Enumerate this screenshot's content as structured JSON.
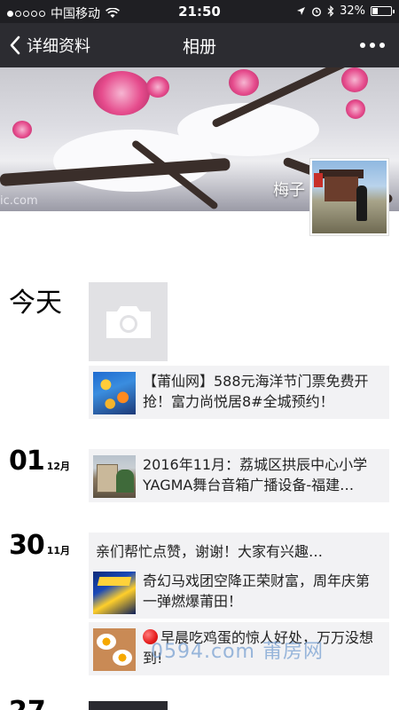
{
  "status_bar": {
    "carrier": "中国移动",
    "time": "21:50",
    "battery": "32%",
    "battery_level": 0.32,
    "icons": [
      "signal-dots-icon",
      "wifi-icon",
      "location-icon",
      "alarm-icon",
      "bluetooth-icon",
      "battery-icon"
    ]
  },
  "nav": {
    "back_label": "详细资料",
    "title": "相册"
  },
  "cover": {
    "watermark": "ic.com",
    "name": "梅子"
  },
  "timeline": {
    "today_label": "今天",
    "days": [
      {
        "day": "01",
        "month": "12月"
      },
      {
        "day": "30",
        "month": "11月"
      },
      {
        "day": "27",
        "month": ""
      }
    ],
    "entries": [
      {
        "text": "【莆仙网】588元海洋节门票免费开抢！富力尚悦居8#全城预约！",
        "thumb": "flowers-thumbnail"
      },
      {
        "text": "2016年11月：荔城区拱辰中心小学YAGMA舞台音箱广播设备-福建…",
        "thumb": "building-thumbnail"
      },
      {
        "text": "亲们帮忙点赞，谢谢！大家有兴趣…"
      },
      {
        "text": "奇幻马戏团空降正荣财富，周年庆第一弹燃爆莆田！",
        "thumb": "circus-thumbnail"
      },
      {
        "text": "早晨吃鸡蛋的惊人好处，万万没想到!",
        "thumb": "eggs-thumbnail"
      }
    ]
  },
  "page_watermark": "0594.com 莆房网",
  "colors": {
    "status_bar_bg": "#1f1f23",
    "nav_bg": "#2c2c31",
    "entry_bg": "#f2f2f4",
    "camera_tile_bg": "#e1e1e4"
  }
}
